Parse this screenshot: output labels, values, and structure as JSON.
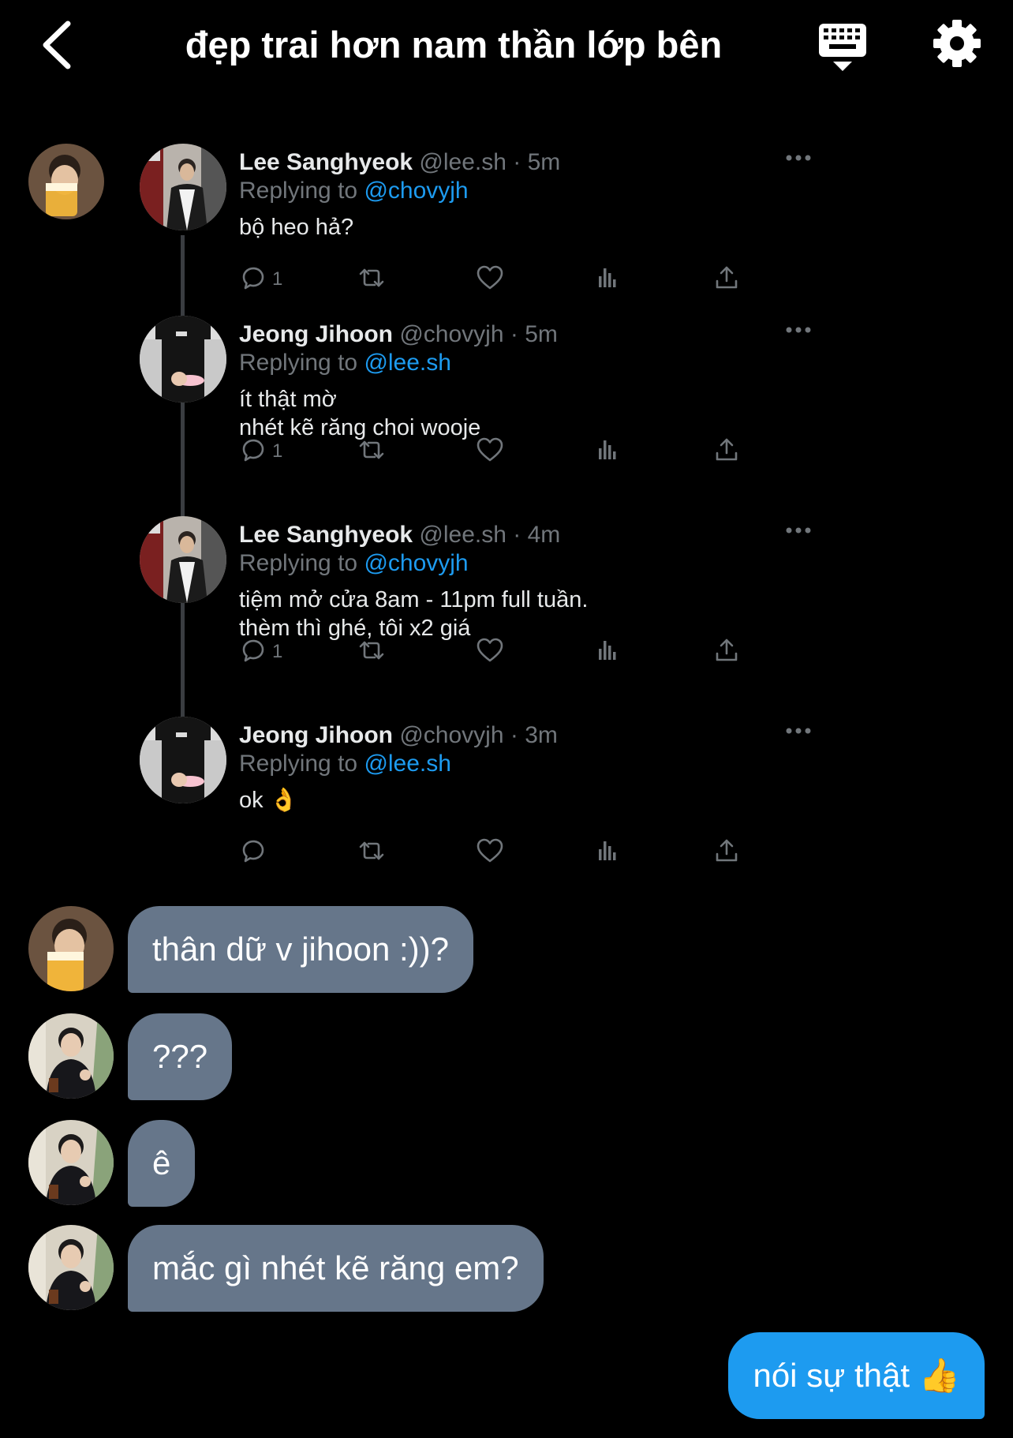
{
  "header": {
    "title": "đẹp trai hơn nam thần lớp bên",
    "back_icon": "chevron-left-icon",
    "keyboard_icon": "keyboard-icon",
    "settings_icon": "gear-icon"
  },
  "thread": {
    "tweets": [
      {
        "name": "Lee Sanghyeok",
        "handle": "@lee.sh",
        "time": "5m",
        "reply_prefix": "Replying to",
        "reply_to": "@chovyjh",
        "text": "bộ heo hả?",
        "reply_count": "1"
      },
      {
        "name": "Jeong Jihoon",
        "handle": "@chovyjh",
        "time": "5m",
        "reply_prefix": "Replying to",
        "reply_to": "@lee.sh",
        "text": "ít thật mờ\nnhét kẽ răng choi wooje",
        "reply_count": "1"
      },
      {
        "name": "Lee Sanghyeok",
        "handle": "@lee.sh",
        "time": "4m",
        "reply_prefix": "Replying to",
        "reply_to": "@chovyjh",
        "text": "tiệm mở cửa 8am - 11pm full tuần.\nthèm thì ghé, tôi x2 giá",
        "reply_count": "1"
      },
      {
        "name": "Jeong Jihoon",
        "handle": "@chovyjh",
        "time": "3m",
        "reply_prefix": "Replying to",
        "reply_to": "@lee.sh",
        "text": "ok 👌",
        "reply_count": ""
      }
    ],
    "separator": "·"
  },
  "messages": [
    {
      "text": "thân dữ v jihoon :))?",
      "from": "lee"
    },
    {
      "text": "???",
      "from": "jihoon"
    },
    {
      "text": "ê",
      "from": "jihoon"
    },
    {
      "text": "mắc gì nhét kẽ răng em?",
      "from": "jihoon"
    },
    {
      "text": "nói sự thật 👍",
      "from": "me"
    }
  ],
  "colors": {
    "background": "#000000",
    "accent": "#1d9bf0",
    "bubble_other": "#66768a",
    "muted": "#71767b"
  }
}
